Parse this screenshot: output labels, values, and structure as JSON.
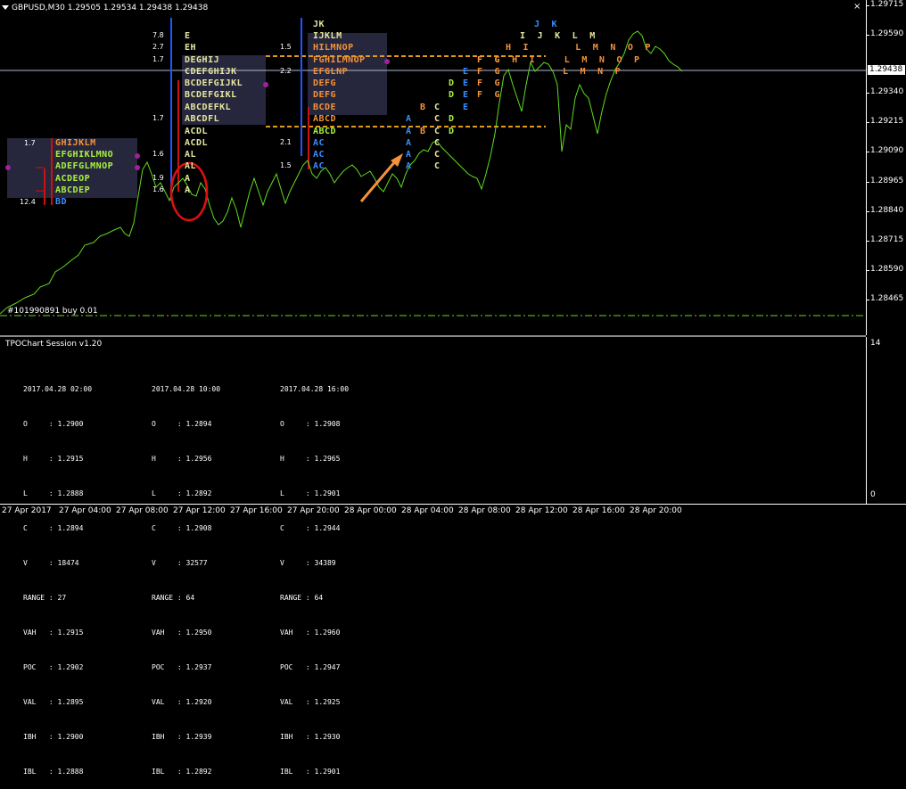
{
  "header": {
    "symbol_line": "GBPUSD,M30  1.29505 1.29534 1.29438 1.29438"
  },
  "close_glyph": "×",
  "price_axis": {
    "ticks": [
      "1.29715",
      "1.29590",
      "1.29340",
      "1.29215",
      "1.29090",
      "1.28965",
      "1.28840",
      "1.28715",
      "1.28590",
      "1.28465"
    ],
    "current_price": "1.29438"
  },
  "order_label": "#101990891 buy 0.01",
  "indicator": {
    "title": "TPOChart Session v1.20",
    "axis_top": "14",
    "axis_bottom": "0",
    "sessions": [
      {
        "date": "2017.04.28 02:00",
        "rows": [
          "O     : 1.2900",
          "H     : 1.2915",
          "L     : 1.2888",
          "C     : 1.2894",
          "V     : 18474",
          "RANGE : 27",
          "VAH   : 1.2915",
          "POC   : 1.2902",
          "VAL   : 1.2895",
          "IBH   : 1.2900",
          "IBL   : 1.2888"
        ]
      },
      {
        "date": "2017.04.28 10:00",
        "rows": [
          "O     : 1.2894",
          "H     : 1.2956",
          "L     : 1.2892",
          "C     : 1.2908",
          "V     : 32577",
          "RANGE : 64",
          "VAH   : 1.2950",
          "POC   : 1.2937",
          "VAL   : 1.2920",
          "IBH   : 1.2939",
          "IBL   : 1.2892"
        ]
      },
      {
        "date": "2017.04.28 16:00",
        "rows": [
          "O     : 1.2908",
          "H     : 1.2965",
          "L     : 1.2901",
          "C     : 1.2944",
          "V     : 34389",
          "RANGE : 64",
          "VAH   : 1.2960",
          "POC   : 1.2947",
          "VAL   : 1.2925",
          "IBH   : 1.2930",
          "IBL   : 1.2901"
        ]
      }
    ]
  },
  "time_axis": [
    "27 Apr 2017",
    "27 Apr 04:00",
    "27 Apr 08:00",
    "27 Apr 12:00",
    "27 Apr 16:00",
    "27 Apr 20:00",
    "28 Apr 00:00",
    "28 Apr 04:00",
    "28 Apr 08:00",
    "28 Apr 12:00",
    "28 Apr 16:00",
    "28 Apr 20:00"
  ],
  "tpo": {
    "profile1": {
      "numbers": [
        "1.7",
        "12.4"
      ],
      "rows": [
        "GHIJKLM",
        "EFGHIKLMNO",
        "ADEFGLMNOP",
        "ACDEOP",
        "ABCDEP",
        "BD"
      ]
    },
    "profile2": {
      "numbers": [
        "7.8",
        "2.7",
        "1.7",
        "1.7",
        "1.6",
        "1.9",
        "1.6"
      ],
      "rows": [
        "E",
        "EH",
        "DEGHIJ",
        "CDEFGHIJK",
        "BCDEFGIJKL",
        "BCDEFGIKL",
        "ABCDEFKL",
        "ABCDFL",
        "ACDL",
        "ACDL",
        "AL",
        "AL",
        "A",
        "A"
      ]
    },
    "profile3": {
      "numbers": [
        "1.5",
        "2.2",
        "2.1",
        "1.5"
      ],
      "rows": [
        "JK",
        "IJKLM",
        "HILMNOP",
        "FGHILMNOP",
        "EFGLNP",
        "DEFG",
        "DEFG",
        "BCDE",
        "ABCD",
        "ABCD",
        "AC",
        "AC",
        "AC"
      ]
    },
    "scattered": {
      "cols_a": [
        "A",
        "A",
        "A",
        "A",
        "A"
      ],
      "cols_b": [
        "B",
        "B"
      ],
      "cols_c": [
        "C",
        "C",
        "C",
        "C",
        "C",
        "C"
      ],
      "cols_d": [
        "D",
        "D",
        "D",
        "D"
      ],
      "cols_e": [
        "E",
        "E",
        "E",
        "E"
      ],
      "cols_fg": [
        "F  G",
        "F  G",
        "F  G",
        "F  G"
      ],
      "top_right_rows": [
        "J  K",
        "I  J  K  L  M",
        "H  I        L  M  N  O  P",
        "F  G  H  I     L  M  N  O  P",
        "L  M  N  P"
      ]
    }
  },
  "colors": {
    "line": "#5fdc1e",
    "poc": "#e39a18",
    "ib_blue": "#2255ff",
    "ib_red": "#cc1111",
    "dot": "#a020a0"
  }
}
